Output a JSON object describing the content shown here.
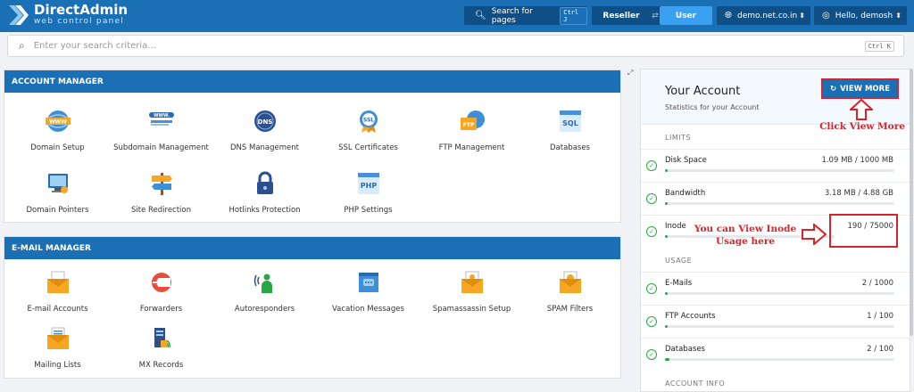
{
  "brand": {
    "title": "DirectAdmin",
    "subtitle": "web control panel"
  },
  "topbar": {
    "search_label": "Search for pages",
    "search_kbd": "Ctrl J",
    "role_reseller": "Reseller",
    "role_user": "User",
    "domain": "demo.net.co.in",
    "greeting": "Hello, demosh"
  },
  "search": {
    "placeholder": "Enter your search criteria...",
    "kbd": "Ctrl K"
  },
  "account_manager": {
    "title": "ACCOUNT MANAGER",
    "items": [
      {
        "label": "Domain Setup",
        "icon": "www-globe-icon"
      },
      {
        "label": "Subdomain Management",
        "icon": "subdomain-icon"
      },
      {
        "label": "DNS Management",
        "icon": "dns-icon"
      },
      {
        "label": "SSL Certificates",
        "icon": "ssl-badge-icon"
      },
      {
        "label": "FTP Management",
        "icon": "ftp-folder-icon"
      },
      {
        "label": "Databases",
        "icon": "sql-database-icon"
      },
      {
        "label": "Domain Pointers",
        "icon": "domain-pointer-icon"
      },
      {
        "label": "Site Redirection",
        "icon": "signpost-icon"
      },
      {
        "label": "Hotlinks Protection",
        "icon": "lock-icon"
      },
      {
        "label": "PHP Settings",
        "icon": "php-icon"
      }
    ]
  },
  "email_manager": {
    "title": "E-MAIL MANAGER",
    "items": [
      {
        "label": "E-mail Accounts",
        "icon": "envelope-icon"
      },
      {
        "label": "Forwarders",
        "icon": "forward-icon"
      },
      {
        "label": "Autoresponders",
        "icon": "autoresponder-icon"
      },
      {
        "label": "Vacation Messages",
        "icon": "vacation-icon"
      },
      {
        "label": "Spamassassin Setup",
        "icon": "spam-envelope-icon"
      },
      {
        "label": "SPAM Filters",
        "icon": "spam-filter-icon"
      },
      {
        "label": "Mailing Lists",
        "icon": "mailing-list-icon"
      },
      {
        "label": "MX Records",
        "icon": "mx-records-icon"
      }
    ]
  },
  "your_account": {
    "title": "Your Account",
    "subtitle": "Statistics for your Account",
    "view_more": "VIEW MORE",
    "limits_label": "LIMITS",
    "usage_label": "USAGE",
    "info_label": "ACCOUNT INFO",
    "limits": [
      {
        "label": "Disk Space",
        "value": "1.09 MB / 1000 MB",
        "fraction": 0.0011
      },
      {
        "label": "Bandwidth",
        "value": "3.18 MB / 4.88 GB",
        "fraction": 0.0007
      },
      {
        "label": "Inode",
        "value": "190 / 75000",
        "fraction": 0.0025
      }
    ],
    "usage": [
      {
        "label": "E-Mails",
        "value": "2 / 1000",
        "fraction": 0.002
      },
      {
        "label": "FTP Accounts",
        "value": "1 / 100",
        "fraction": 0.01
      },
      {
        "label": "Databases",
        "value": "2 / 100",
        "fraction": 0.02
      }
    ]
  },
  "annotations": {
    "click_view_more": "Click View More",
    "inode_line1": "You can View Inode",
    "inode_line2": "Usage here"
  },
  "colors": {
    "brand_blue": "#1a6fb5",
    "accent_red": "#d8232a",
    "success_green": "#27a844"
  }
}
